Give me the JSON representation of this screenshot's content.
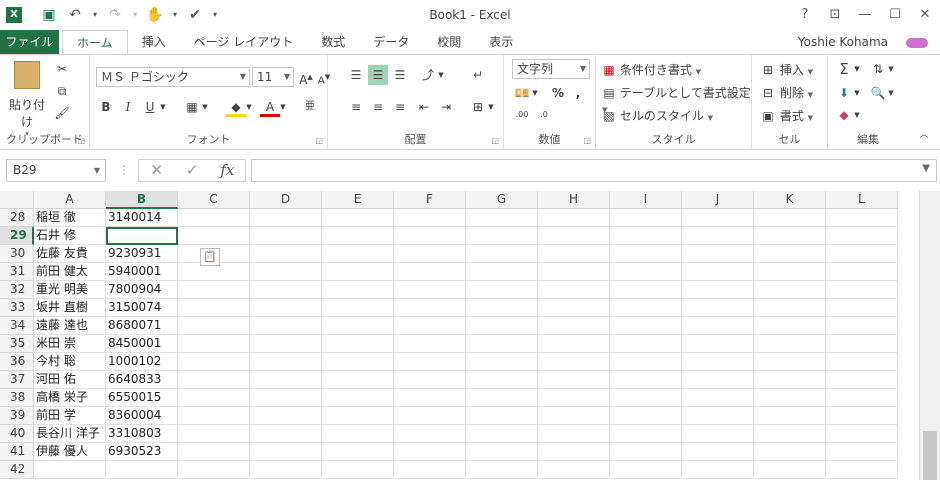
{
  "app": {
    "logo": "X",
    "title": "Book1 - Excel",
    "window_buttons": [
      "?",
      "⊡",
      "—",
      "☐",
      "✕"
    ]
  },
  "tabs": {
    "file": "ファイル",
    "items": [
      "ホーム",
      "挿入",
      "ページ レイアウト",
      "数式",
      "データ",
      "校閲",
      "表示"
    ],
    "active": "ホーム",
    "user": "Yoshie Kohama"
  },
  "ribbon": {
    "clipboard": {
      "paste": "貼り付け",
      "label": "クリップボード"
    },
    "font": {
      "name": "ＭＳ Ｐゴシック",
      "size": "11",
      "label": "フォント",
      "bold": "B",
      "italic": "I",
      "underline": "U"
    },
    "alignment": {
      "label": "配置"
    },
    "number": {
      "format": "文字列",
      "label": "数値"
    },
    "styles": {
      "conditional": "条件付き書式",
      "table": "テーブルとして書式設定",
      "cell_styles": "セルのスタイル",
      "label": "スタイル"
    },
    "cells": {
      "insert": "挿入",
      "delete": "削除",
      "format": "書式",
      "label": "セル"
    },
    "editing": {
      "label": "編集"
    }
  },
  "formula_bar": {
    "name_box": "B29",
    "value": ""
  },
  "sheet": {
    "columns": [
      "A",
      "B",
      "C",
      "D",
      "E",
      "F",
      "G",
      "H",
      "I",
      "J",
      "K",
      "L"
    ],
    "active_column": "B",
    "active_row": "29",
    "rows": [
      {
        "n": "28",
        "a": "稲垣 徹",
        "b": "3140014"
      },
      {
        "n": "29",
        "a": "石井 修",
        "b": ""
      },
      {
        "n": "30",
        "a": "佐藤 友貴",
        "b": "9230931"
      },
      {
        "n": "31",
        "a": "前田 健太",
        "b": "5940001"
      },
      {
        "n": "32",
        "a": "重光 明美",
        "b": "7800904"
      },
      {
        "n": "33",
        "a": "坂井 直樹",
        "b": "3150074"
      },
      {
        "n": "34",
        "a": "遠藤 達也",
        "b": "8680071"
      },
      {
        "n": "35",
        "a": "米田 崇",
        "b": "8450001"
      },
      {
        "n": "36",
        "a": "今村 聡",
        "b": "1000102"
      },
      {
        "n": "37",
        "a": "河田 佑",
        "b": "6640833"
      },
      {
        "n": "38",
        "a": "高橋 栄子",
        "b": "6550015"
      },
      {
        "n": "39",
        "a": "前田 学",
        "b": "8360004"
      },
      {
        "n": "40",
        "a": "長谷川 洋子",
        "b": "3310803"
      },
      {
        "n": "41",
        "a": "伊藤 優人",
        "b": "6930523"
      },
      {
        "n": "42",
        "a": "",
        "b": ""
      }
    ]
  },
  "colors": {
    "accent": "#217346",
    "selected_align": "#9fd5b7"
  }
}
